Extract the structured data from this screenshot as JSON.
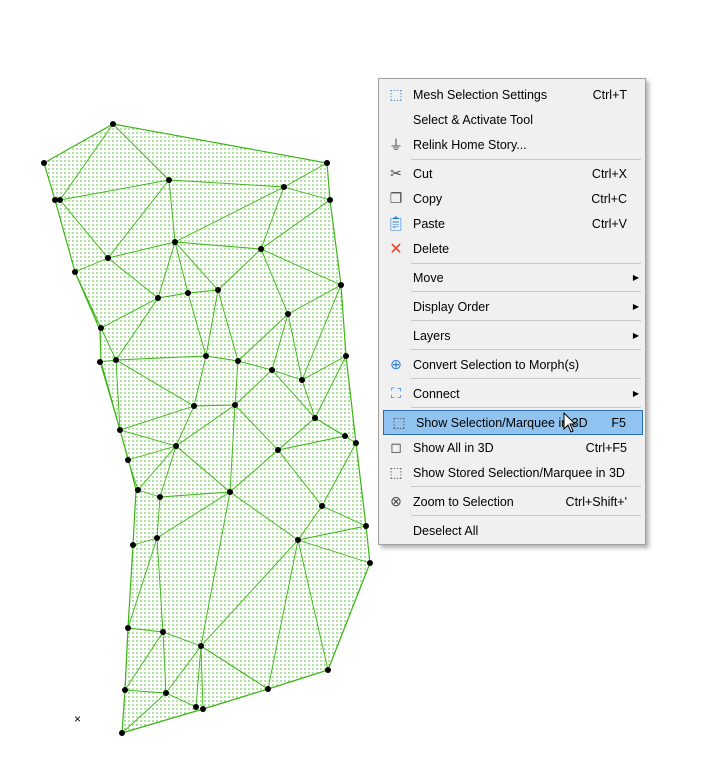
{
  "menu": {
    "items": [
      {
        "label": "Mesh Selection Settings",
        "shortcut": "Ctrl+T",
        "icon": "mesh-settings-icon"
      },
      {
        "label": "Select & Activate Tool",
        "shortcut": "",
        "icon": ""
      },
      {
        "label": "Relink Home Story...",
        "shortcut": "",
        "icon": "relink-story-icon"
      },
      {
        "label": "Cut",
        "shortcut": "Ctrl+X",
        "icon": "scissors-icon"
      },
      {
        "label": "Copy",
        "shortcut": "Ctrl+C",
        "icon": "copy-icon"
      },
      {
        "label": "Paste",
        "shortcut": "Ctrl+V",
        "icon": "paste-icon"
      },
      {
        "label": "Delete",
        "shortcut": "",
        "icon": "delete-x-icon"
      },
      {
        "label": "Move",
        "submenu": true
      },
      {
        "label": "Display Order",
        "submenu": true
      },
      {
        "label": "Layers",
        "submenu": true
      },
      {
        "label": "Convert Selection to Morph(s)",
        "shortcut": "",
        "icon": "morph-icon"
      },
      {
        "label": "Connect",
        "submenu": true,
        "icon": "connect-icon"
      },
      {
        "label": "Show Selection/Marquee in 3D",
        "shortcut": "F5",
        "icon": "cube-dashed-icon"
      },
      {
        "label": "Show All in 3D",
        "shortcut": "Ctrl+F5",
        "icon": "cube-icon"
      },
      {
        "label": "Show Stored Selection/Marquee in 3D",
        "shortcut": "",
        "icon": "cube-stored-icon"
      },
      {
        "label": "Zoom to Selection",
        "shortcut": "Ctrl+Shift+'",
        "icon": "zoom-selection-icon"
      },
      {
        "label": "Deselect All",
        "shortcut": ""
      }
    ]
  },
  "colors": {
    "mesh": "#3cb416",
    "highlight": "#91c3f0"
  }
}
